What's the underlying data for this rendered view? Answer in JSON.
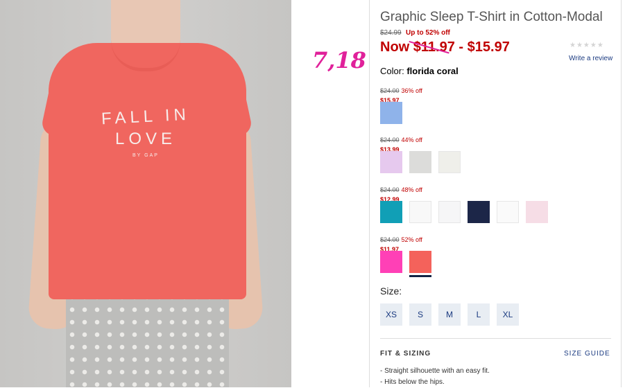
{
  "annotation": "7,18",
  "shirt_print": {
    "line1": "FALL IN",
    "line2": "LOVE",
    "line3": "BY GAP"
  },
  "product": {
    "title": "Graphic Sleep T-Shirt in Cotton-Modal",
    "original_price": "$24.99",
    "discount": "Up to 52% off",
    "now_prefix": "Now",
    "now_low": "$11.97",
    "now_sep": " - ",
    "now_high": "$15.97",
    "rating_stars": "★★★★★",
    "write_review": "Write a review",
    "color_label": "Color:",
    "color_value": "florida coral"
  },
  "price_groups": [
    {
      "was": "$24.00",
      "off": "36% off",
      "now": "$15.97",
      "swatches": [
        {
          "name": "light blue",
          "color": "#8fb3ea"
        }
      ]
    },
    {
      "was": "$24.00",
      "off": "44% off",
      "now": "$13.99",
      "swatches": [
        {
          "name": "lavender",
          "color": "#e6c9ee"
        },
        {
          "name": "heather grey",
          "color": "#dcdcda"
        },
        {
          "name": "ivory",
          "color": "#efefea"
        }
      ]
    },
    {
      "was": "$24.00",
      "off": "48% off",
      "now": "$12.99",
      "swatches": [
        {
          "name": "teal",
          "color": "#119fb6"
        },
        {
          "name": "white",
          "color": "#f8f8f8"
        },
        {
          "name": "white 2",
          "color": "#f6f6f7"
        },
        {
          "name": "navy",
          "color": "#1c2648"
        },
        {
          "name": "white 3",
          "color": "#fafafa"
        },
        {
          "name": "pale pink",
          "color": "#f6dde6"
        }
      ]
    },
    {
      "was": "$24.00",
      "off": "52% off",
      "now": "$11.97",
      "swatches": [
        {
          "name": "hot pink",
          "color": "#ff40b6"
        },
        {
          "name": "florida coral",
          "color": "#f4625b",
          "selected": true
        }
      ]
    }
  ],
  "size": {
    "label": "Size:",
    "options": [
      "XS",
      "S",
      "M",
      "L",
      "XL"
    ]
  },
  "fit": {
    "title": "FIT & SIZING",
    "guide": "SIZE GUIDE",
    "bullets": [
      "- Straight silhouette with an easy fit.",
      "- Hits below the hips."
    ]
  }
}
